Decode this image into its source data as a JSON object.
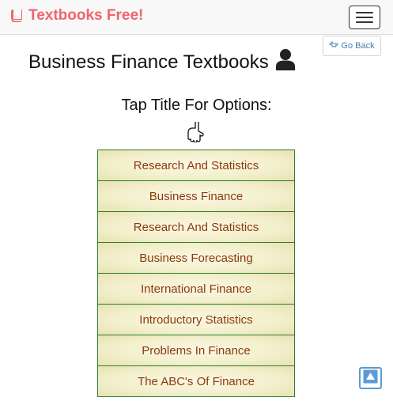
{
  "navbar": {
    "brand_label": "Textbooks Free!",
    "brand_icon": "book-icon",
    "menu_icon": "hamburger-icon",
    "brand_color": "#f16470"
  },
  "header": {
    "go_back_label": "Go Back",
    "go_back_icon": "hand-pointing-left-icon",
    "title": "Business Finance Textbooks",
    "title_icon": "user-icon",
    "subtitle": "Tap Title For Options:",
    "subtitle_icon": "hand-pointing-down-icon"
  },
  "books": [
    "Research And Statistics",
    "Business Finance",
    "Research And Statistics",
    "Business Forecasting",
    "International Finance",
    "Introductory Statistics",
    "Problems In Finance",
    "The ABC's Of Finance"
  ],
  "colors": {
    "item_text": "#8b3a0f",
    "item_border": "#2e7d32",
    "item_background": "#f2efcc",
    "scroll_top_accent": "#5b9bd5"
  },
  "scroll_top_icon": "arrow-up-icon"
}
